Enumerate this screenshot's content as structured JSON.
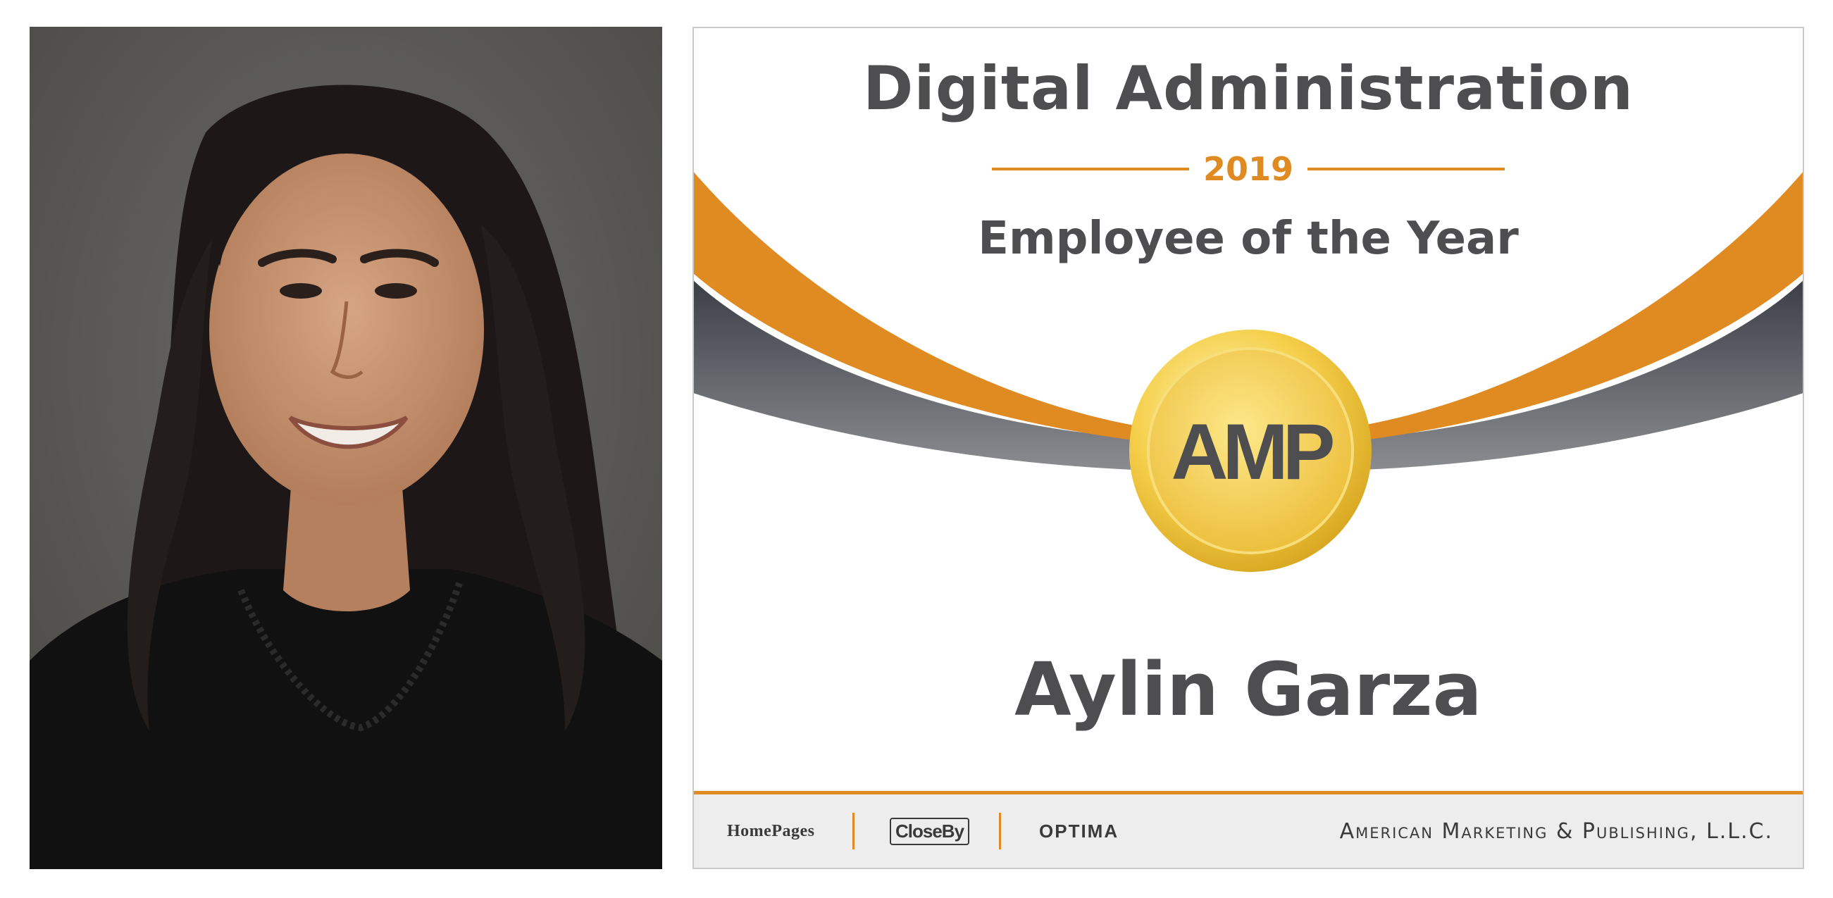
{
  "certificate": {
    "title": "Digital Administration",
    "year": "2019",
    "award": "Employee of the Year",
    "recipient": "Aylin Garza",
    "medal_logo": "AMP",
    "footer": {
      "logos": [
        "HomePages",
        "CloseBy",
        "OPTIMA"
      ],
      "company": "American Marketing & Publishing, L.L.C."
    }
  },
  "colors": {
    "accent": "#e08a22",
    "text_dark": "#4e4e50",
    "swoosh_gray": "#6e7075",
    "gold": "#f2c94c",
    "footer_bg": "#ededed"
  },
  "icons": {
    "medal": "gold-medal-icon"
  }
}
